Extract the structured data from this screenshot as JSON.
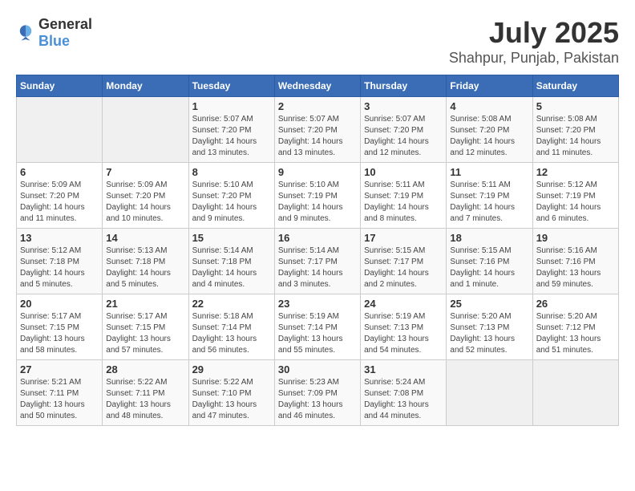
{
  "logo": {
    "text_general": "General",
    "text_blue": "Blue"
  },
  "title": "July 2025",
  "subtitle": "Shahpur, Punjab, Pakistan",
  "days_of_week": [
    "Sunday",
    "Monday",
    "Tuesday",
    "Wednesday",
    "Thursday",
    "Friday",
    "Saturday"
  ],
  "weeks": [
    [
      {
        "day": "",
        "info": ""
      },
      {
        "day": "",
        "info": ""
      },
      {
        "day": "1",
        "info": "Sunrise: 5:07 AM\nSunset: 7:20 PM\nDaylight: 14 hours and 13 minutes."
      },
      {
        "day": "2",
        "info": "Sunrise: 5:07 AM\nSunset: 7:20 PM\nDaylight: 14 hours and 13 minutes."
      },
      {
        "day": "3",
        "info": "Sunrise: 5:07 AM\nSunset: 7:20 PM\nDaylight: 14 hours and 12 minutes."
      },
      {
        "day": "4",
        "info": "Sunrise: 5:08 AM\nSunset: 7:20 PM\nDaylight: 14 hours and 12 minutes."
      },
      {
        "day": "5",
        "info": "Sunrise: 5:08 AM\nSunset: 7:20 PM\nDaylight: 14 hours and 11 minutes."
      }
    ],
    [
      {
        "day": "6",
        "info": "Sunrise: 5:09 AM\nSunset: 7:20 PM\nDaylight: 14 hours and 11 minutes."
      },
      {
        "day": "7",
        "info": "Sunrise: 5:09 AM\nSunset: 7:20 PM\nDaylight: 14 hours and 10 minutes."
      },
      {
        "day": "8",
        "info": "Sunrise: 5:10 AM\nSunset: 7:20 PM\nDaylight: 14 hours and 9 minutes."
      },
      {
        "day": "9",
        "info": "Sunrise: 5:10 AM\nSunset: 7:19 PM\nDaylight: 14 hours and 9 minutes."
      },
      {
        "day": "10",
        "info": "Sunrise: 5:11 AM\nSunset: 7:19 PM\nDaylight: 14 hours and 8 minutes."
      },
      {
        "day": "11",
        "info": "Sunrise: 5:11 AM\nSunset: 7:19 PM\nDaylight: 14 hours and 7 minutes."
      },
      {
        "day": "12",
        "info": "Sunrise: 5:12 AM\nSunset: 7:19 PM\nDaylight: 14 hours and 6 minutes."
      }
    ],
    [
      {
        "day": "13",
        "info": "Sunrise: 5:12 AM\nSunset: 7:18 PM\nDaylight: 14 hours and 5 minutes."
      },
      {
        "day": "14",
        "info": "Sunrise: 5:13 AM\nSunset: 7:18 PM\nDaylight: 14 hours and 5 minutes."
      },
      {
        "day": "15",
        "info": "Sunrise: 5:14 AM\nSunset: 7:18 PM\nDaylight: 14 hours and 4 minutes."
      },
      {
        "day": "16",
        "info": "Sunrise: 5:14 AM\nSunset: 7:17 PM\nDaylight: 14 hours and 3 minutes."
      },
      {
        "day": "17",
        "info": "Sunrise: 5:15 AM\nSunset: 7:17 PM\nDaylight: 14 hours and 2 minutes."
      },
      {
        "day": "18",
        "info": "Sunrise: 5:15 AM\nSunset: 7:16 PM\nDaylight: 14 hours and 1 minute."
      },
      {
        "day": "19",
        "info": "Sunrise: 5:16 AM\nSunset: 7:16 PM\nDaylight: 13 hours and 59 minutes."
      }
    ],
    [
      {
        "day": "20",
        "info": "Sunrise: 5:17 AM\nSunset: 7:15 PM\nDaylight: 13 hours and 58 minutes."
      },
      {
        "day": "21",
        "info": "Sunrise: 5:17 AM\nSunset: 7:15 PM\nDaylight: 13 hours and 57 minutes."
      },
      {
        "day": "22",
        "info": "Sunrise: 5:18 AM\nSunset: 7:14 PM\nDaylight: 13 hours and 56 minutes."
      },
      {
        "day": "23",
        "info": "Sunrise: 5:19 AM\nSunset: 7:14 PM\nDaylight: 13 hours and 55 minutes."
      },
      {
        "day": "24",
        "info": "Sunrise: 5:19 AM\nSunset: 7:13 PM\nDaylight: 13 hours and 54 minutes."
      },
      {
        "day": "25",
        "info": "Sunrise: 5:20 AM\nSunset: 7:13 PM\nDaylight: 13 hours and 52 minutes."
      },
      {
        "day": "26",
        "info": "Sunrise: 5:20 AM\nSunset: 7:12 PM\nDaylight: 13 hours and 51 minutes."
      }
    ],
    [
      {
        "day": "27",
        "info": "Sunrise: 5:21 AM\nSunset: 7:11 PM\nDaylight: 13 hours and 50 minutes."
      },
      {
        "day": "28",
        "info": "Sunrise: 5:22 AM\nSunset: 7:11 PM\nDaylight: 13 hours and 48 minutes."
      },
      {
        "day": "29",
        "info": "Sunrise: 5:22 AM\nSunset: 7:10 PM\nDaylight: 13 hours and 47 minutes."
      },
      {
        "day": "30",
        "info": "Sunrise: 5:23 AM\nSunset: 7:09 PM\nDaylight: 13 hours and 46 minutes."
      },
      {
        "day": "31",
        "info": "Sunrise: 5:24 AM\nSunset: 7:08 PM\nDaylight: 13 hours and 44 minutes."
      },
      {
        "day": "",
        "info": ""
      },
      {
        "day": "",
        "info": ""
      }
    ]
  ]
}
